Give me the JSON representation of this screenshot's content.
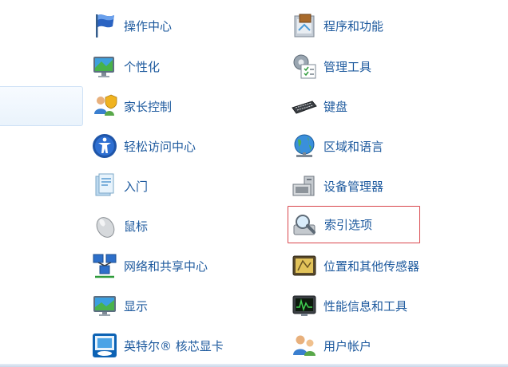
{
  "control_panel": {
    "left_column": [
      {
        "id": "action-center",
        "label": "操作中心",
        "icon": "flag-icon"
      },
      {
        "id": "personalization",
        "label": "个性化",
        "icon": "personalization-icon"
      },
      {
        "id": "parental-controls",
        "label": "家长控制",
        "icon": "parental-controls-icon"
      },
      {
        "id": "ease-of-access",
        "label": "轻松访问中心",
        "icon": "accessibility-icon"
      },
      {
        "id": "getting-started",
        "label": "入门",
        "icon": "getting-started-icon"
      },
      {
        "id": "mouse",
        "label": "鼠标",
        "icon": "mouse-icon"
      },
      {
        "id": "network-sharing",
        "label": "网络和共享中心",
        "icon": "network-icon"
      },
      {
        "id": "display",
        "label": "显示",
        "icon": "display-icon"
      },
      {
        "id": "intel-graphics",
        "label": "英特尔® 核芯显卡",
        "icon": "intel-graphics-icon"
      }
    ],
    "right_column": [
      {
        "id": "programs-features",
        "label": "程序和功能",
        "icon": "programs-icon"
      },
      {
        "id": "admin-tools",
        "label": "管理工具",
        "icon": "admin-tools-icon"
      },
      {
        "id": "keyboard",
        "label": "键盘",
        "icon": "keyboard-icon"
      },
      {
        "id": "region-language",
        "label": "区域和语言",
        "icon": "globe-icon"
      },
      {
        "id": "device-manager",
        "label": "设备管理器",
        "icon": "device-manager-icon"
      },
      {
        "id": "indexing-options",
        "label": "索引选项",
        "icon": "magnifier-icon",
        "highlighted": true
      },
      {
        "id": "location-sensors",
        "label": "位置和其他传感器",
        "icon": "sensor-icon"
      },
      {
        "id": "performance",
        "label": "性能信息和工具",
        "icon": "performance-icon"
      },
      {
        "id": "user-accounts",
        "label": "用户帐户",
        "icon": "user-accounts-icon"
      }
    ]
  },
  "colors": {
    "link": "#1e5a9e",
    "highlight_border": "#d9454b"
  }
}
